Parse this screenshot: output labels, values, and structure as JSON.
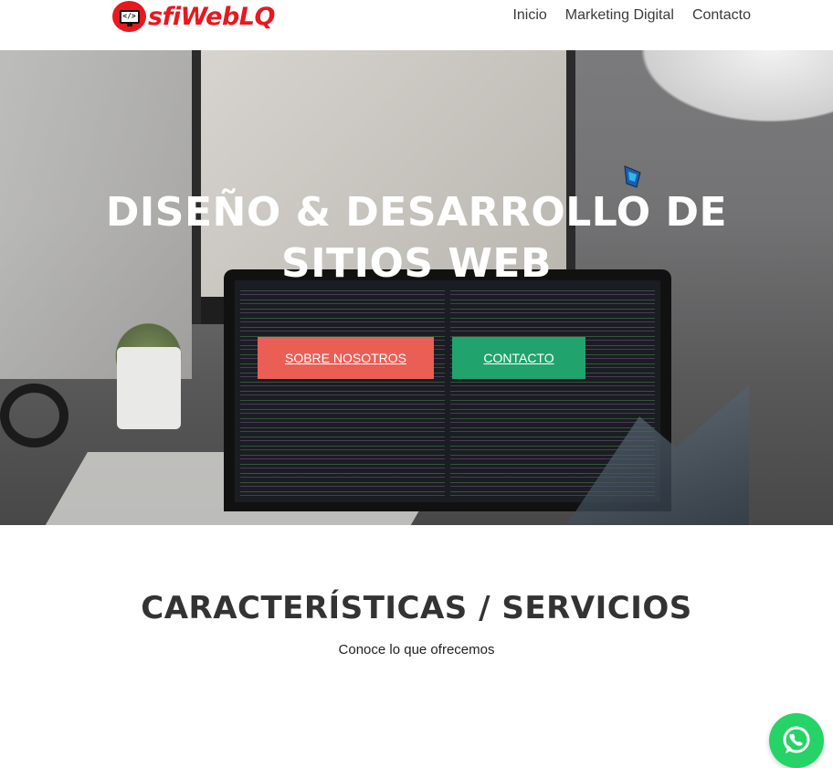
{
  "header": {
    "logo_text": "sfiWebLQ",
    "logo_badge_glyph": "</>",
    "nav": [
      "Inicio",
      "Marketing Digital",
      "Contacto"
    ]
  },
  "hero": {
    "title_line1": "DISEÑO & DESARROLLO DE",
    "title_line2": "SITIOS WEB",
    "buttons": {
      "about": "SOBRE NOSOTROS",
      "contact": "CONTACTO"
    }
  },
  "features": {
    "title": "CARACTERÍSTICAS / SERVICIOS",
    "subtitle": "Conoce lo que ofrecemos"
  },
  "floating": {
    "whatsapp_icon": "whatsapp-icon"
  },
  "colors": {
    "brand_red": "#e6191f",
    "button_about": "#e95f55",
    "button_contact": "#21a36e",
    "whatsapp_green": "#25d366",
    "heading": "#333333"
  }
}
